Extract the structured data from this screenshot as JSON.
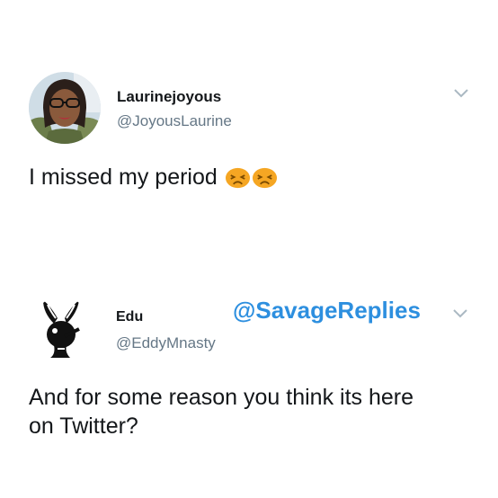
{
  "tweets": [
    {
      "display_name": "Laurinejoyous",
      "handle": "@JoyousLaurine",
      "text": "I missed my period",
      "emoji": [
        "persevering-face",
        "persevering-face"
      ]
    },
    {
      "display_name": "Edu",
      "handle": "@EddyMnasty",
      "text_lines": [
        "And for some reason you think its here",
        "on Twitter?"
      ]
    }
  ],
  "watermark": "@SavageReplies",
  "colors": {
    "accent": "#2d8fdf",
    "text": "#14171a",
    "secondary": "#657786",
    "chevron": "#aab8c2",
    "emoji": "#f5a623"
  },
  "icons": {
    "more": "chevron-down-icon",
    "avatar_2": "bunny-logo-icon"
  }
}
